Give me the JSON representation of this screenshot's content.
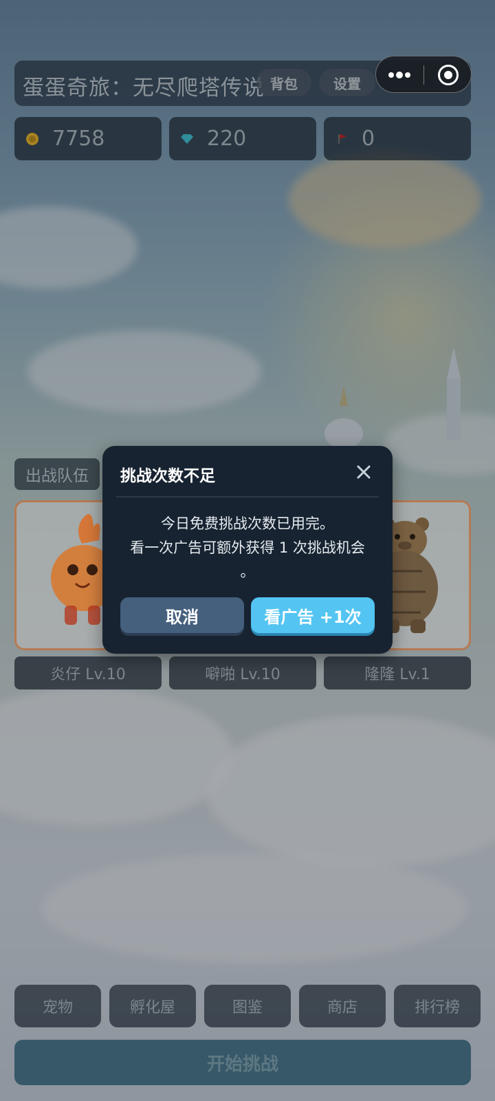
{
  "header": {
    "title": "蛋蛋奇旅：无尽爬塔传说",
    "bag_label": "背包",
    "settings_label": "设置"
  },
  "resources": {
    "coins": "7758",
    "gems": "220",
    "flags": "0"
  },
  "team": {
    "label": "出战队伍",
    "pets": [
      {
        "name": "炎仔 Lv.10"
      },
      {
        "name": "噼啪 Lv.10"
      },
      {
        "name": "隆隆 Lv.1"
      }
    ]
  },
  "nav": {
    "items": [
      {
        "label": "宠物"
      },
      {
        "label": "孵化屋"
      },
      {
        "label": "图鉴"
      },
      {
        "label": "商店"
      },
      {
        "label": "排行榜"
      }
    ],
    "start_label": "开始挑战"
  },
  "modal": {
    "title": "挑战次数不足",
    "line1": "今日免费挑战次数已用完。",
    "line2": "看一次广告可额外获得 1 次挑战机会",
    "line3": "。",
    "cancel_label": "取消",
    "ad_label": "看广告 +1次"
  },
  "colors": {
    "accent": "#54c5f2",
    "modal_bg": "#172331",
    "cancel_bg": "#45607d"
  }
}
